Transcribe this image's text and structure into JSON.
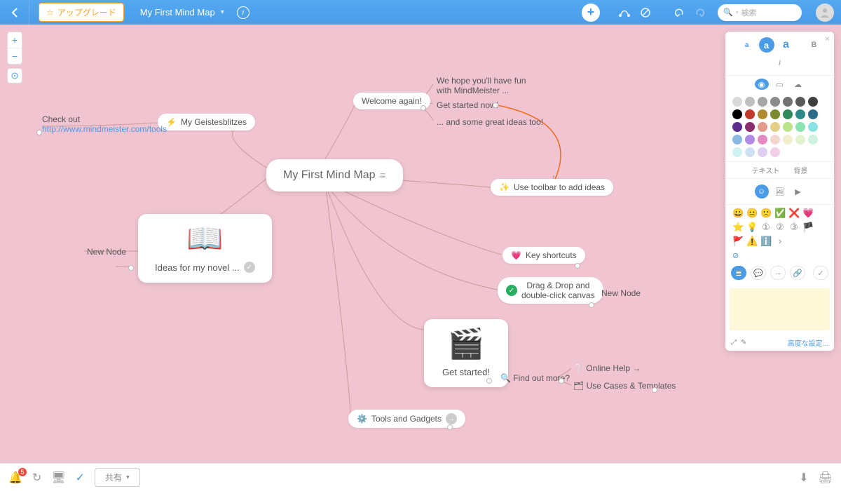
{
  "topbar": {
    "upgrade_label": "アップグレード",
    "title": "My First Mind Map",
    "search_placeholder": "検索"
  },
  "nodes": {
    "root": "My First Mind Map",
    "geistesblitzes": "My Geistesblitzes",
    "checkout_label": "Check out",
    "checkout_url": "http://www.mindmeister.com/tools",
    "welcome": "Welcome again!",
    "welcome_sub1a": "We hope you'll have fun",
    "welcome_sub1b": "with MindMeister ...",
    "welcome_sub2": "Get started now!",
    "welcome_sub3": "... and some great ideas too!",
    "toolbar_tip": "Use toolbar to add ideas",
    "ideas_novel": "Ideas for my novel ...",
    "new_node": "New Node",
    "key_shortcuts": "Key shortcuts",
    "drag_drop_a": "Drag & Drop and",
    "drag_drop_b": "double-click canvas",
    "get_started": "Get started!",
    "find_out_more": "Find out more?",
    "online_help": "Online Help",
    "use_cases": "Use Cases & Templates",
    "tools_gadgets": "Tools and Gadgets"
  },
  "panel": {
    "tab_text": "テキスト",
    "tab_bg": "背景",
    "advanced": "高度な設定...",
    "swatches": [
      "#d9d9d9",
      "#bfbfbf",
      "#a6a6a6",
      "#8c8c8c",
      "#737373",
      "#595959",
      "#404040",
      "#000000",
      "#c0392b",
      "#b08a2e",
      "#7a8a2e",
      "#2e8a5a",
      "#2e8a8a",
      "#2e6d8a",
      "#5a2e8a",
      "#8a2e6d",
      "#e39a8a",
      "#e3cf8a",
      "#b9e38a",
      "#8ae3b0",
      "#8ae3e3",
      "#8ab9e3",
      "#b08ae3",
      "#e38ac4",
      "#f2d7cf",
      "#f2edcf",
      "#e3f2cf",
      "#cff2e0",
      "#cff2f2",
      "#cfe0f2",
      "#e0cff2",
      "#f2cfe8"
    ],
    "emojis_row1": [
      "😀",
      "😐",
      "🙁",
      "✅",
      "❌",
      "💗",
      "⭐",
      "💡"
    ],
    "emojis_row2": [
      "①",
      "②",
      "③",
      "🏴",
      "🚩",
      "⚠️",
      "ℹ️",
      "›"
    ]
  },
  "bottombar": {
    "share_label": "共有",
    "notif_count": "5"
  }
}
